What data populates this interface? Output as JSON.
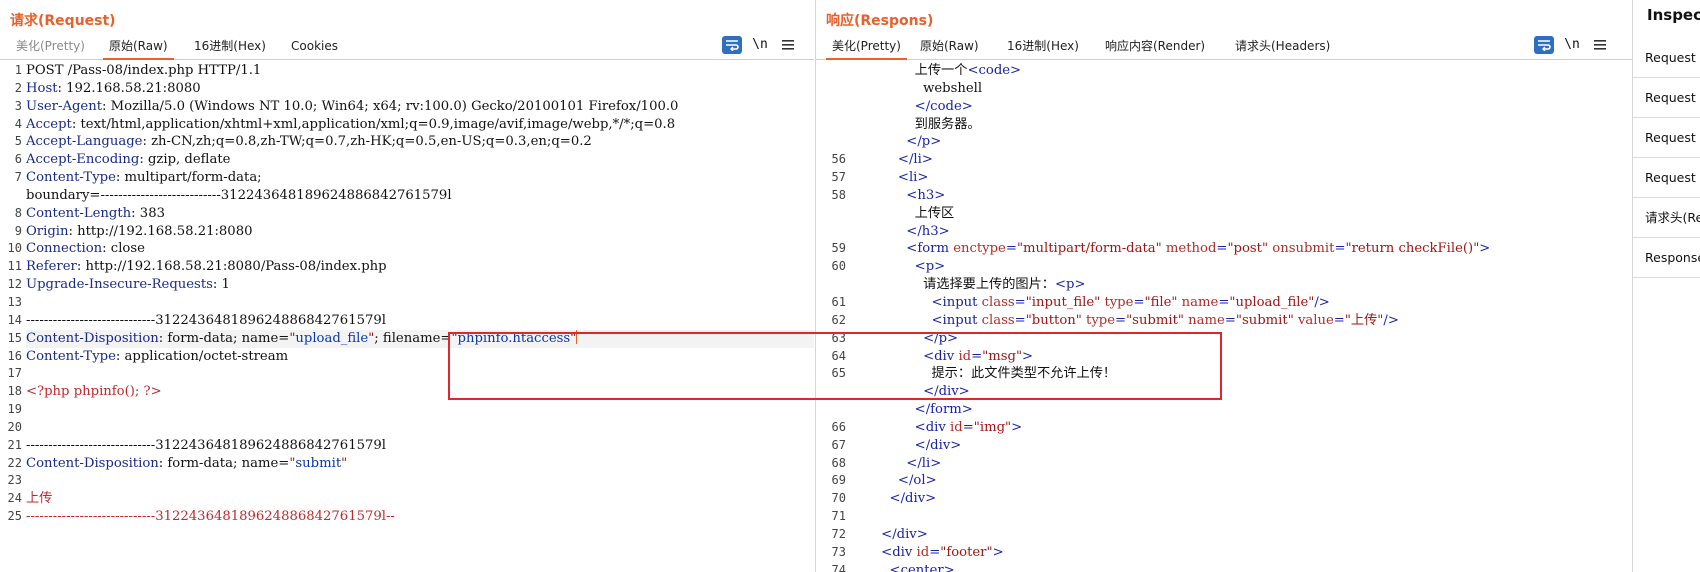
{
  "request": {
    "title": "请求(Request)",
    "tabs": [
      "美化(Pretty)",
      "原始(Raw)",
      "16进制(Hex)",
      "Cookies"
    ],
    "active_tab": "原始(Raw)",
    "newline_toggle": "\\n",
    "lines": [
      {
        "n": "1",
        "segs": [
          [
            "v",
            "POST /Pass-08/index.php HTTP/1.1"
          ]
        ]
      },
      {
        "n": "2",
        "segs": [
          [
            "k",
            "Host"
          ],
          [
            "v",
            ": 192.168.58.21:8080"
          ]
        ]
      },
      {
        "n": "3",
        "segs": [
          [
            "k",
            "User-Agent"
          ],
          [
            "v",
            ": Mozilla/5.0 (Windows NT 10.0; Win64; x64; rv:100.0) Gecko/20100101 Firefox/100.0"
          ]
        ]
      },
      {
        "n": "4",
        "segs": [
          [
            "k",
            "Accept"
          ],
          [
            "v",
            ": text/html,application/xhtml+xml,application/xml;q=0.9,image/avif,image/webp,*/*;q=0.8"
          ]
        ]
      },
      {
        "n": "5",
        "segs": [
          [
            "k",
            "Accept-Language"
          ],
          [
            "v",
            ": zh-CN,zh;q=0.8,zh-TW;q=0.7,zh-HK;q=0.5,en-US;q=0.3,en;q=0.2"
          ]
        ]
      },
      {
        "n": "6",
        "segs": [
          [
            "k",
            "Accept-Encoding"
          ],
          [
            "v",
            ": gzip, deflate"
          ]
        ]
      },
      {
        "n": "7",
        "segs": [
          [
            "k",
            "Content-Type"
          ],
          [
            "v",
            ": multipart/form-data;"
          ]
        ]
      },
      {
        "n": "",
        "segs": [
          [
            "v",
            "boundary=---------------------------312243648189624886842761579l"
          ]
        ]
      },
      {
        "n": "8",
        "segs": [
          [
            "k",
            "Content-Length"
          ],
          [
            "v",
            ": 383"
          ]
        ]
      },
      {
        "n": "9",
        "segs": [
          [
            "k",
            "Origin"
          ],
          [
            "v",
            ": http://192.168.58.21:8080"
          ]
        ]
      },
      {
        "n": "10",
        "segs": [
          [
            "k",
            "Connection"
          ],
          [
            "v",
            ": close"
          ]
        ]
      },
      {
        "n": "11",
        "segs": [
          [
            "k",
            "Referer"
          ],
          [
            "v",
            ": http://192.168.58.21:8080/Pass-08/index.php"
          ]
        ]
      },
      {
        "n": "12",
        "segs": [
          [
            "k",
            "Upgrade-Insecure-Requests"
          ],
          [
            "v",
            ": 1"
          ]
        ]
      },
      {
        "n": "13",
        "segs": []
      },
      {
        "n": "14",
        "segs": [
          [
            "v",
            "-----------------------------312243648189624886842761579l"
          ]
        ]
      },
      {
        "n": "15",
        "segs": [
          [
            "k",
            "Content-Disposition"
          ],
          [
            "v",
            ": form-data; name="
          ],
          [
            "q",
            "\""
          ],
          [
            "bv",
            "upload_file"
          ],
          [
            "q",
            "\""
          ],
          [
            "v",
            "; filename="
          ],
          [
            "q",
            "\""
          ],
          [
            "bv",
            "phpinfo.htaccess"
          ],
          [
            "q",
            "\""
          ]
        ],
        "cursorline": true
      },
      {
        "n": "16",
        "segs": [
          [
            "k",
            "Content-Type"
          ],
          [
            "v",
            ": application/octet-stream"
          ]
        ]
      },
      {
        "n": "17",
        "segs": []
      },
      {
        "n": "18",
        "segs": [
          [
            "red",
            "<?php phpinfo(); ?>"
          ]
        ]
      },
      {
        "n": "19",
        "segs": []
      },
      {
        "n": "20",
        "segs": []
      },
      {
        "n": "21",
        "segs": [
          [
            "v",
            "-----------------------------312243648189624886842761579l"
          ]
        ]
      },
      {
        "n": "22",
        "segs": [
          [
            "k",
            "Content-Disposition"
          ],
          [
            "v",
            ": form-data; name="
          ],
          [
            "q",
            "\""
          ],
          [
            "bv",
            "submit"
          ],
          [
            "q",
            "\""
          ]
        ]
      },
      {
        "n": "23",
        "segs": []
      },
      {
        "n": "24",
        "segs": [
          [
            "red",
            "上传"
          ]
        ]
      },
      {
        "n": "25",
        "segs": [
          [
            "red",
            "-----------------------------312243648189624886842761579l--"
          ]
        ]
      }
    ]
  },
  "response": {
    "title": "响应(Respons)",
    "tabs": [
      "美化(Pretty)",
      "原始(Raw)",
      "16进制(Hex)",
      "响应内容(Render)",
      "请求头(Headers)"
    ],
    "active_tab": "美化(Pretty)",
    "newline_toggle": "\\n",
    "lines": [
      {
        "n": "",
        "segs": [
          [
            "t",
            "              上传一个"
          ],
          [
            "tag",
            "<code>"
          ]
        ]
      },
      {
        "n": "",
        "segs": [
          [
            "t",
            "                webshell"
          ]
        ]
      },
      {
        "n": "",
        "segs": [
          [
            "tag",
            "              </code>"
          ]
        ]
      },
      {
        "n": "",
        "segs": [
          [
            "t",
            "              到服务器。"
          ]
        ]
      },
      {
        "n": "",
        "segs": [
          [
            "tag",
            "            </p>"
          ]
        ]
      },
      {
        "n": "56",
        "segs": [
          [
            "tag",
            "          </li>"
          ]
        ]
      },
      {
        "n": "57",
        "segs": [
          [
            "tag",
            "          <li>"
          ]
        ]
      },
      {
        "n": "58",
        "segs": [
          [
            "tag",
            "            <h3>"
          ]
        ]
      },
      {
        "n": "",
        "segs": [
          [
            "t",
            "              上传区"
          ]
        ]
      },
      {
        "n": "",
        "segs": [
          [
            "tag",
            "            </h3>"
          ]
        ]
      },
      {
        "n": "59",
        "segs": [
          [
            "tag",
            "            <form "
          ],
          [
            "attr",
            "enctype"
          ],
          [
            "tag",
            "="
          ],
          [
            "q",
            "\"multipart/form-data\""
          ],
          [
            "tag",
            " "
          ],
          [
            "attr",
            "method"
          ],
          [
            "tag",
            "="
          ],
          [
            "q",
            "\"post\""
          ],
          [
            "tag",
            " "
          ],
          [
            "attr",
            "onsubmit"
          ],
          [
            "tag",
            "="
          ],
          [
            "q",
            "\"return checkFile()\""
          ],
          [
            "tag",
            ">"
          ]
        ]
      },
      {
        "n": "60",
        "segs": [
          [
            "tag",
            "              <p>"
          ]
        ]
      },
      {
        "n": "",
        "segs": [
          [
            "t",
            "                请选择要上传的图片："
          ],
          [
            "tag",
            "<p>"
          ]
        ]
      },
      {
        "n": "61",
        "segs": [
          [
            "tag",
            "                  <input "
          ],
          [
            "attr",
            "class"
          ],
          [
            "tag",
            "="
          ],
          [
            "q",
            "\"input_file\""
          ],
          [
            "tag",
            " "
          ],
          [
            "attr",
            "type"
          ],
          [
            "tag",
            "="
          ],
          [
            "q",
            "\"file\""
          ],
          [
            "tag",
            " "
          ],
          [
            "attr",
            "name"
          ],
          [
            "tag",
            "="
          ],
          [
            "q",
            "\"upload_file\""
          ],
          [
            "tag",
            "/>"
          ]
        ]
      },
      {
        "n": "62",
        "segs": [
          [
            "tag",
            "                  <input "
          ],
          [
            "attr",
            "class"
          ],
          [
            "tag",
            "="
          ],
          [
            "q",
            "\"button\""
          ],
          [
            "tag",
            " "
          ],
          [
            "attr",
            "type"
          ],
          [
            "tag",
            "="
          ],
          [
            "q",
            "\"submit\""
          ],
          [
            "tag",
            " "
          ],
          [
            "attr",
            "name"
          ],
          [
            "tag",
            "="
          ],
          [
            "q",
            "\"submit\""
          ],
          [
            "tag",
            " "
          ],
          [
            "attr",
            "value"
          ],
          [
            "tag",
            "="
          ],
          [
            "q",
            "\"上传\""
          ],
          [
            "tag",
            "/>"
          ]
        ]
      },
      {
        "n": "63",
        "segs": [
          [
            "tag",
            "                </p>"
          ]
        ]
      },
      {
        "n": "64",
        "segs": [
          [
            "tag",
            "                <div "
          ],
          [
            "attr",
            "id"
          ],
          [
            "tag",
            "="
          ],
          [
            "q",
            "\"msg\""
          ],
          [
            "tag",
            ">"
          ]
        ]
      },
      {
        "n": "65",
        "segs": [
          [
            "t",
            "                  提示：此文件类型不允许上传！"
          ]
        ]
      },
      {
        "n": "",
        "segs": [
          [
            "tag",
            "                </div>"
          ]
        ]
      },
      {
        "n": "",
        "segs": [
          [
            "tag",
            "              </form>"
          ]
        ]
      },
      {
        "n": "66",
        "segs": [
          [
            "tag",
            "              <div "
          ],
          [
            "attr",
            "id"
          ],
          [
            "tag",
            "="
          ],
          [
            "q",
            "\"img\""
          ],
          [
            "tag",
            ">"
          ]
        ]
      },
      {
        "n": "67",
        "segs": [
          [
            "tag",
            "              </div>"
          ]
        ]
      },
      {
        "n": "68",
        "segs": [
          [
            "tag",
            "            </li>"
          ]
        ]
      },
      {
        "n": "69",
        "segs": [
          [
            "tag",
            "          </ol>"
          ]
        ]
      },
      {
        "n": "70",
        "segs": [
          [
            "tag",
            "        </div>"
          ]
        ]
      },
      {
        "n": "71",
        "segs": []
      },
      {
        "n": "72",
        "segs": [
          [
            "tag",
            "      </div>"
          ]
        ]
      },
      {
        "n": "73",
        "segs": [
          [
            "tag",
            "      <div "
          ],
          [
            "attr",
            "id"
          ],
          [
            "tag",
            "="
          ],
          [
            "q",
            "\"footer\""
          ],
          [
            "tag",
            ">"
          ]
        ]
      },
      {
        "n": "74",
        "segs": [
          [
            "tag",
            "        <center>"
          ]
        ]
      }
    ]
  },
  "inspector": {
    "title": "Inspecto",
    "items": [
      "Request A",
      "Request (",
      "Request B",
      "Request C",
      "请求头(Re",
      "Response"
    ]
  },
  "colors": {
    "accent": "#e8602c",
    "highlight_box": "#e0262c",
    "tool_blue": "#2f6fc0"
  }
}
